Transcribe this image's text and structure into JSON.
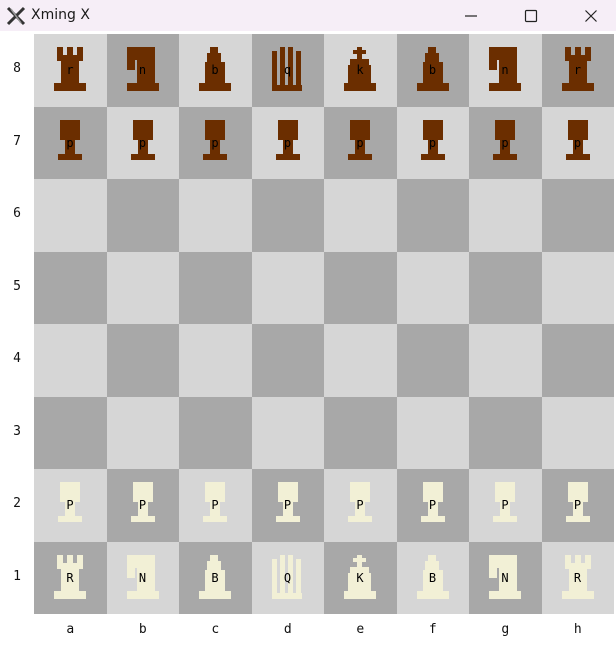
{
  "window": {
    "title": "Xming X",
    "icon": "xming-x-icon",
    "controls": [
      "minimize-icon",
      "maximize-icon",
      "close-icon"
    ]
  },
  "board": {
    "files": [
      "a",
      "b",
      "c",
      "d",
      "e",
      "f",
      "g",
      "h"
    ],
    "ranks": [
      "8",
      "7",
      "6",
      "5",
      "4",
      "3",
      "2",
      "1"
    ],
    "colors": {
      "light_square": "#d6d6d6",
      "dark_square": "#a8a8a8",
      "black_piece": "#6b2e00",
      "white_piece": "#f2f0d6"
    },
    "position": [
      [
        "r",
        "n",
        "b",
        "q",
        "k",
        "b",
        "n",
        "r"
      ],
      [
        "p",
        "p",
        "p",
        "p",
        "p",
        "p",
        "p",
        "p"
      ],
      [
        "",
        "",
        "",
        "",
        "",
        "",
        "",
        ""
      ],
      [
        "",
        "",
        "",
        "",
        "",
        "",
        "",
        ""
      ],
      [
        "",
        "",
        "",
        "",
        "",
        "",
        "",
        ""
      ],
      [
        "",
        "",
        "",
        "",
        "",
        "",
        "",
        ""
      ],
      [
        "P",
        "P",
        "P",
        "P",
        "P",
        "P",
        "P",
        "P"
      ],
      [
        "R",
        "N",
        "B",
        "Q",
        "K",
        "B",
        "N",
        "R"
      ]
    ]
  }
}
